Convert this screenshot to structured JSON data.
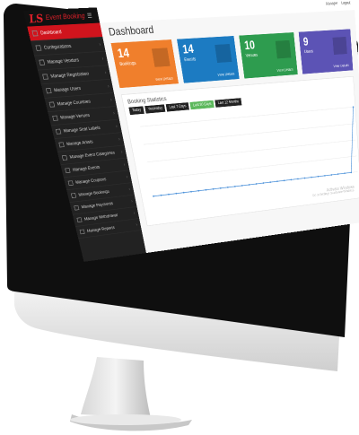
{
  "app": {
    "logo": "LS",
    "name": "Event Booking",
    "toggle_icon": "menu-icon"
  },
  "sidebar": {
    "items": [
      {
        "label": "Dashboard",
        "active": true
      },
      {
        "label": "Configurations",
        "active": false
      },
      {
        "label": "Manage Vendors",
        "active": false
      },
      {
        "label": "Manage Registration",
        "active": false
      },
      {
        "label": "Manage Users",
        "active": false
      },
      {
        "label": "Manage Countries",
        "active": false
      },
      {
        "label": "Manage Venues",
        "active": false
      },
      {
        "label": "Manage Seat Labels",
        "active": false
      },
      {
        "label": "Manage Artists",
        "active": false
      },
      {
        "label": "Manage Event Categories",
        "active": false
      },
      {
        "label": "Manage Events",
        "active": false
      },
      {
        "label": "Manage Coupons",
        "active": false
      },
      {
        "label": "Manage Bookings",
        "active": false
      },
      {
        "label": "Manage Payments",
        "active": false
      },
      {
        "label": "Manage Withdrawal",
        "active": false
      },
      {
        "label": "Manage Reports",
        "active": false
      }
    ]
  },
  "header": {
    "user": "Manager",
    "logout": "Logout"
  },
  "page": {
    "title": "Dashboard"
  },
  "tiles": [
    {
      "number": "14",
      "label": "Bookings",
      "more": "View Details",
      "color": "#f07f2c"
    },
    {
      "number": "14",
      "label": "Events",
      "more": "View Details",
      "color": "#1c7bc2"
    },
    {
      "number": "10",
      "label": "Venues",
      "more": "View Details",
      "color": "#2e9c4f"
    },
    {
      "number": "9",
      "label": "Users",
      "more": "View Details",
      "color": "#5c53b5"
    }
  ],
  "stats": {
    "title": "Booking Statistics",
    "tabs": [
      {
        "label": "Today",
        "active": false
      },
      {
        "label": "Yesterday",
        "active": false
      },
      {
        "label": "Last 7 Days",
        "active": false
      },
      {
        "label": "Last 30 Days",
        "active": true
      },
      {
        "label": "Last 12 Months",
        "active": false
      }
    ]
  },
  "watermark": {
    "line1": "Activate Windows",
    "line2": "Go to Settings to activate Windows."
  },
  "chart_data": {
    "type": "line",
    "title": "",
    "xlabel": "",
    "ylabel": "",
    "y": [
      0,
      0,
      0,
      0,
      0,
      0,
      0,
      0,
      0,
      0,
      0,
      0,
      0,
      0,
      0,
      0,
      0,
      0,
      0,
      0,
      0,
      0,
      0,
      0,
      0,
      0,
      0,
      0,
      0,
      1
    ],
    "ylim": [
      0,
      1
    ],
    "grid": true,
    "color": "#4a90d9"
  }
}
